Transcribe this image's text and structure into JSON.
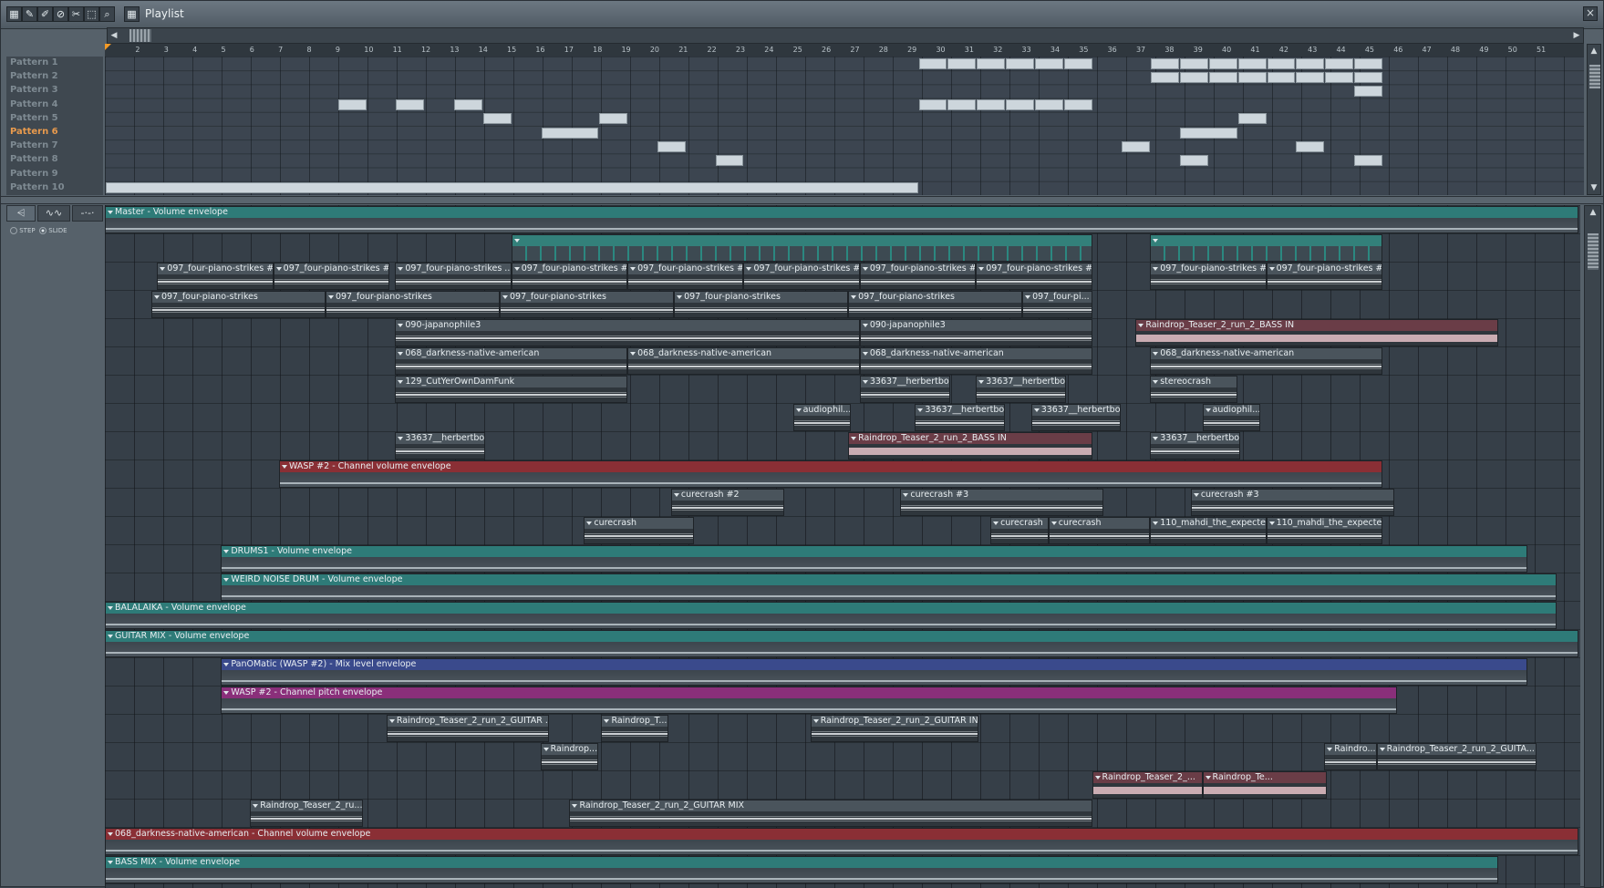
{
  "window": {
    "title": "Playlist",
    "close_glyph": "×"
  },
  "toolbar_icons": [
    "pattern-icon",
    "pencil-icon",
    "brush-icon",
    "mute-icon",
    "slice-icon",
    "select-icon",
    "zoom-icon",
    "snap-icon"
  ],
  "ruler": {
    "numbers": [
      "2",
      "3",
      "4",
      "5",
      "6",
      "7",
      "8",
      "9",
      "10",
      "11",
      "12",
      "13",
      "14",
      "15",
      "16",
      "17",
      "18",
      "19",
      "20",
      "21",
      "22",
      "23",
      "24",
      "25",
      "26",
      "27",
      "28",
      "29",
      "30",
      "31",
      "32",
      "33",
      "34",
      "35",
      "36",
      "37",
      "38",
      "39",
      "40",
      "41",
      "42",
      "43",
      "44",
      "45",
      "46",
      "47",
      "48",
      "49",
      "50",
      "51"
    ]
  },
  "patterns": {
    "names": [
      "Pattern 1",
      "Pattern 2",
      "Pattern 3",
      "Pattern 4",
      "Pattern 5",
      "Pattern 6",
      "Pattern 7",
      "Pattern 8",
      "Pattern 9",
      "Pattern 10"
    ],
    "active_index": 5,
    "blocks": [
      {
        "row": 0,
        "start": 29,
        "len": 1
      },
      {
        "row": 0,
        "start": 30,
        "len": 1
      },
      {
        "row": 0,
        "start": 31,
        "len": 1
      },
      {
        "row": 0,
        "start": 32,
        "len": 1
      },
      {
        "row": 0,
        "start": 33,
        "len": 1
      },
      {
        "row": 0,
        "start": 34,
        "len": 1
      },
      {
        "row": 0,
        "start": 37,
        "len": 1
      },
      {
        "row": 0,
        "start": 38,
        "len": 1
      },
      {
        "row": 0,
        "start": 39,
        "len": 1
      },
      {
        "row": 0,
        "start": 40,
        "len": 1
      },
      {
        "row": 0,
        "start": 41,
        "len": 1
      },
      {
        "row": 0,
        "start": 42,
        "len": 1
      },
      {
        "row": 0,
        "start": 43,
        "len": 1
      },
      {
        "row": 0,
        "start": 44,
        "len": 1
      },
      {
        "row": 1,
        "start": 37,
        "len": 1
      },
      {
        "row": 1,
        "start": 38,
        "len": 1
      },
      {
        "row": 1,
        "start": 39,
        "len": 1
      },
      {
        "row": 1,
        "start": 40,
        "len": 1
      },
      {
        "row": 1,
        "start": 41,
        "len": 1
      },
      {
        "row": 1,
        "start": 42,
        "len": 1
      },
      {
        "row": 1,
        "start": 43,
        "len": 1
      },
      {
        "row": 1,
        "start": 44,
        "len": 1
      },
      {
        "row": 2,
        "start": 44,
        "len": 1
      },
      {
        "row": 3,
        "start": 9,
        "len": 1
      },
      {
        "row": 3,
        "start": 11,
        "len": 1
      },
      {
        "row": 3,
        "start": 13,
        "len": 1
      },
      {
        "row": 3,
        "start": 29,
        "len": 1
      },
      {
        "row": 3,
        "start": 30,
        "len": 1
      },
      {
        "row": 3,
        "start": 31,
        "len": 1
      },
      {
        "row": 3,
        "start": 32,
        "len": 1
      },
      {
        "row": 3,
        "start": 33,
        "len": 1
      },
      {
        "row": 3,
        "start": 34,
        "len": 1
      },
      {
        "row": 4,
        "start": 14,
        "len": 1
      },
      {
        "row": 4,
        "start": 18,
        "len": 1
      },
      {
        "row": 4,
        "start": 40,
        "len": 1
      },
      {
        "row": 5,
        "start": 16,
        "len": 2
      },
      {
        "row": 5,
        "start": 38,
        "len": 2
      },
      {
        "row": 6,
        "start": 20,
        "len": 1
      },
      {
        "row": 6,
        "start": 36,
        "len": 1
      },
      {
        "row": 6,
        "start": 42,
        "len": 1
      },
      {
        "row": 7,
        "start": 22,
        "len": 1
      },
      {
        "row": 7,
        "start": 38,
        "len": 1
      },
      {
        "row": 7,
        "start": 44,
        "len": 1
      },
      {
        "row": 9,
        "start": 1,
        "len": 28
      }
    ]
  },
  "modes": {
    "step_label": "STEP",
    "slide_label": "SLIDE"
  },
  "clips": [
    {
      "row": 0,
      "start": 1,
      "len": 51,
      "kind": "env",
      "color": "teal",
      "label": "Master - Volume envelope"
    },
    {
      "row": 1,
      "start": 15,
      "len": 20,
      "kind": "pattern",
      "label": ""
    },
    {
      "row": 1,
      "start": 37,
      "len": 8,
      "kind": "pattern",
      "label": ""
    },
    {
      "row": 2,
      "start": 2.8,
      "len": 4,
      "kind": "audio",
      "label": "097_four-piano-strikes #2"
    },
    {
      "row": 2,
      "start": 6.8,
      "len": 4,
      "kind": "audio",
      "label": "097_four-piano-strikes #2"
    },
    {
      "row": 2,
      "start": 11,
      "len": 4,
      "kind": "audio",
      "label": "097_four-piano-strikes ..."
    },
    {
      "row": 2,
      "start": 15,
      "len": 4,
      "kind": "audio",
      "label": "097_four-piano-strikes #2"
    },
    {
      "row": 2,
      "start": 19,
      "len": 4,
      "kind": "audio",
      "label": "097_four-piano-strikes #2"
    },
    {
      "row": 2,
      "start": 23,
      "len": 4,
      "kind": "audio",
      "label": "097_four-piano-strikes #2"
    },
    {
      "row": 2,
      "start": 27,
      "len": 4,
      "kind": "audio",
      "label": "097_four-piano-strikes #2"
    },
    {
      "row": 2,
      "start": 31,
      "len": 4,
      "kind": "audio",
      "label": "097_four-piano-strikes #2"
    },
    {
      "row": 2,
      "start": 37,
      "len": 4,
      "kind": "audio",
      "label": "097_four-piano-strikes #2"
    },
    {
      "row": 2,
      "start": 41,
      "len": 4,
      "kind": "audio",
      "label": "097_four-piano-strikes #2"
    },
    {
      "row": 3,
      "start": 2.6,
      "len": 6,
      "kind": "audio",
      "label": "097_four-piano-strikes"
    },
    {
      "row": 3,
      "start": 8.6,
      "len": 6,
      "kind": "audio",
      "label": "097_four-piano-strikes"
    },
    {
      "row": 3,
      "start": 14.6,
      "len": 6,
      "kind": "audio",
      "label": "097_four-piano-strikes"
    },
    {
      "row": 3,
      "start": 20.6,
      "len": 6,
      "kind": "audio",
      "label": "097_four-piano-strikes"
    },
    {
      "row": 3,
      "start": 26.6,
      "len": 6,
      "kind": "audio",
      "label": "097_four-piano-strikes"
    },
    {
      "row": 3,
      "start": 32.6,
      "len": 2.4,
      "kind": "audio",
      "label": "097_four-pi..."
    },
    {
      "row": 4,
      "start": 11,
      "len": 16,
      "kind": "audio",
      "label": "090-japanophile3"
    },
    {
      "row": 4,
      "start": 27,
      "len": 8,
      "kind": "audio",
      "label": "090-japanophile3"
    },
    {
      "row": 4,
      "start": 36.5,
      "len": 12.5,
      "kind": "audio",
      "pink": true,
      "label": "Raindrop_Teaser_2_run_2_BASS IN"
    },
    {
      "row": 5,
      "start": 11,
      "len": 8,
      "kind": "audio",
      "label": "068_darkness-native-american"
    },
    {
      "row": 5,
      "start": 19,
      "len": 8,
      "kind": "audio",
      "label": "068_darkness-native-american"
    },
    {
      "row": 5,
      "start": 27,
      "len": 8,
      "kind": "audio",
      "label": "068_darkness-native-american"
    },
    {
      "row": 5,
      "start": 37,
      "len": 8,
      "kind": "audio",
      "label": "068_darkness-native-american"
    },
    {
      "row": 6,
      "start": 11,
      "len": 8,
      "kind": "audio",
      "label": "129_CutYerOwnDamFunk"
    },
    {
      "row": 6,
      "start": 27,
      "len": 3.1,
      "kind": "audio",
      "label": "33637__herbertbo..."
    },
    {
      "row": 6,
      "start": 31,
      "len": 3.1,
      "kind": "audio",
      "label": "33637__herbertbo..."
    },
    {
      "row": 6,
      "start": 37,
      "len": 3,
      "kind": "audio",
      "label": "stereocrash"
    },
    {
      "row": 7,
      "start": 24.7,
      "len": 2,
      "kind": "audio",
      "label": "audiophil..."
    },
    {
      "row": 7,
      "start": 28.9,
      "len": 3.1,
      "kind": "audio",
      "label": "33637__herbertbo..."
    },
    {
      "row": 7,
      "start": 32.9,
      "len": 3.1,
      "kind": "audio",
      "label": "33637__herbertbo..."
    },
    {
      "row": 7,
      "start": 38.8,
      "len": 2,
      "kind": "audio",
      "label": "audiophil..."
    },
    {
      "row": 8,
      "start": 11,
      "len": 3.1,
      "kind": "audio",
      "label": "33637__herbertbo..."
    },
    {
      "row": 8,
      "start": 26.6,
      "len": 8.4,
      "kind": "audio",
      "pink": true,
      "label": "Raindrop_Teaser_2_run_2_BASS IN"
    },
    {
      "row": 8,
      "start": 37,
      "len": 3.1,
      "kind": "audio",
      "label": "33637__herbertbo..."
    },
    {
      "row": 9,
      "start": 7,
      "len": 38,
      "kind": "env",
      "color": "red",
      "label": "WASP #2 - Channel volume envelope"
    },
    {
      "row": 10,
      "start": 20.5,
      "len": 3.9,
      "kind": "audio",
      "label": "curecrash #2"
    },
    {
      "row": 10,
      "start": 28.4,
      "len": 7,
      "kind": "audio",
      "label": "curecrash #3"
    },
    {
      "row": 10,
      "start": 38.4,
      "len": 7,
      "kind": "audio",
      "label": "curecrash #3"
    },
    {
      "row": 11,
      "start": 17.5,
      "len": 3.8,
      "kind": "audio",
      "label": "curecrash"
    },
    {
      "row": 11,
      "start": 31.5,
      "len": 2,
      "kind": "audio",
      "label": "curecrash"
    },
    {
      "row": 11,
      "start": 33.5,
      "len": 3.5,
      "kind": "audio",
      "label": "curecrash"
    },
    {
      "row": 11,
      "start": 37,
      "len": 4,
      "kind": "audio",
      "label": "110_mahdi_the_expecte..."
    },
    {
      "row": 11,
      "start": 41,
      "len": 4,
      "kind": "audio",
      "label": "110_mahdi_the_expecte..."
    },
    {
      "row": 12,
      "start": 5,
      "len": 45,
      "kind": "env",
      "color": "teal",
      "label": "DRUMS1 - Volume envelope"
    },
    {
      "row": 13,
      "start": 5,
      "len": 46,
      "kind": "env",
      "color": "teal",
      "label": "WEIRD NOISE DRUM - Volume envelope"
    },
    {
      "row": 14,
      "start": 1,
      "len": 50,
      "kind": "env",
      "color": "teal",
      "label": "BALALAIKA - Volume envelope"
    },
    {
      "row": 15,
      "start": 1,
      "len": 51,
      "kind": "env",
      "color": "teal",
      "label": "GUITAR MIX - Volume envelope"
    },
    {
      "row": 16,
      "start": 5,
      "len": 45,
      "kind": "env",
      "color": "blue",
      "label": "PanOMatic (WASP #2) - Mix level envelope"
    },
    {
      "row": 17,
      "start": 5,
      "len": 40.5,
      "kind": "env",
      "color": "mag",
      "label": "WASP #2 - Channel pitch envelope"
    },
    {
      "row": 18,
      "start": 10.7,
      "len": 5.6,
      "kind": "audio",
      "label": "Raindrop_Teaser_2_run_2_GUITAR ..."
    },
    {
      "row": 18,
      "start": 18.1,
      "len": 2.3,
      "kind": "audio",
      "label": "Raindrop_T..."
    },
    {
      "row": 18,
      "start": 25.3,
      "len": 5.8,
      "kind": "audio",
      "label": "Raindrop_Teaser_2_run_2_GUITAR IN"
    },
    {
      "row": 19,
      "start": 16,
      "len": 2,
      "kind": "audio",
      "label": "Raindrop..."
    },
    {
      "row": 19,
      "start": 43,
      "len": 1.8,
      "kind": "audio",
      "label": "Raindro..."
    },
    {
      "row": 19,
      "start": 44.8,
      "len": 5.5,
      "kind": "audio",
      "label": "Raindrop_Teaser_2_run_2_GUITA..."
    },
    {
      "row": 20,
      "start": 35,
      "len": 3.8,
      "kind": "audio",
      "pink": true,
      "label": "Raindrop_Teaser_2_..."
    },
    {
      "row": 20,
      "start": 38.8,
      "len": 4.3,
      "kind": "audio",
      "pink": true,
      "label": "Raindrop_Te..."
    },
    {
      "row": 21,
      "start": 6,
      "len": 3.9,
      "kind": "audio",
      "label": "Raindrop_Teaser_2_ru..."
    },
    {
      "row": 21,
      "start": 17,
      "len": 18,
      "kind": "audio",
      "label": "Raindrop_Teaser_2_run_2_GUITAR MIX"
    },
    {
      "row": 22,
      "start": 1,
      "len": 51,
      "kind": "env",
      "color": "red",
      "label": "068_darkness-native-american - Channel volume envelope"
    },
    {
      "row": 23,
      "start": 1,
      "len": 48,
      "kind": "env",
      "color": "teal",
      "label": "BASS MIX - Volume envelope"
    }
  ]
}
